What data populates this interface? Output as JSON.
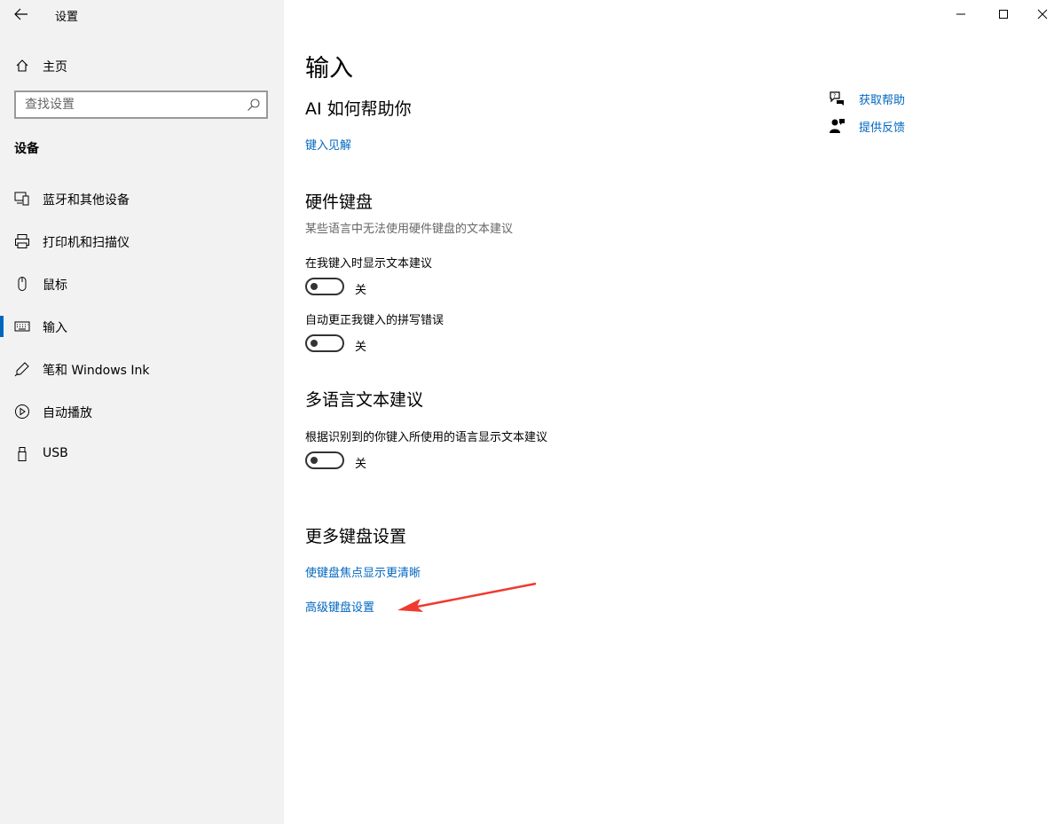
{
  "window": {
    "title": "设置",
    "accent_color": "#0067c0"
  },
  "sidebar": {
    "home_label": "主页",
    "search_placeholder": "查找设置",
    "section_title": "设备",
    "items": [
      {
        "label": "蓝牙和其他设备",
        "icon": "bluetooth-devices-icon"
      },
      {
        "label": "打印机和扫描仪",
        "icon": "printer-icon"
      },
      {
        "label": "鼠标",
        "icon": "mouse-icon"
      },
      {
        "label": "输入",
        "icon": "keyboard-icon",
        "active": true
      },
      {
        "label": "笔和 Windows Ink",
        "icon": "pen-icon"
      },
      {
        "label": "自动播放",
        "icon": "autoplay-icon"
      },
      {
        "label": "USB",
        "icon": "usb-icon"
      }
    ]
  },
  "main": {
    "title": "输入",
    "ai_section": {
      "heading": "AI 如何帮助你",
      "link": "键入见解"
    },
    "hardware_keyboard": {
      "heading": "硬件键盘",
      "description": "某些语言中无法使用硬件键盘的文本建议",
      "settings": [
        {
          "label": "在我键入时显示文本建议",
          "state": "关",
          "on": false
        },
        {
          "label": "自动更正我键入的拼写错误",
          "state": "关",
          "on": false
        }
      ]
    },
    "multilingual": {
      "heading": "多语言文本建议",
      "settings": [
        {
          "label": "根据识别到的你键入所使用的语言显示文本建议",
          "state": "关",
          "on": false
        }
      ]
    },
    "more_keyboard": {
      "heading": "更多键盘设置",
      "links": [
        "使键盘焦点显示更清晰",
        "高级键盘设置"
      ]
    }
  },
  "help": {
    "get_help": "获取帮助",
    "feedback": "提供反馈"
  },
  "annotation": {
    "arrow_color": "#f03a2e"
  }
}
